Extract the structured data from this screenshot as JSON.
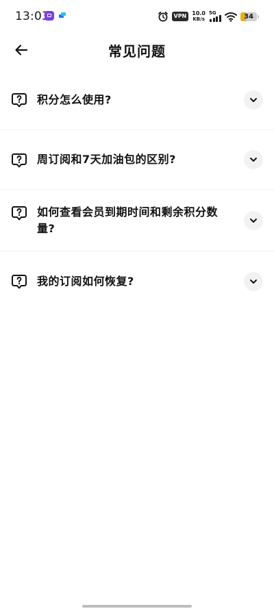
{
  "status_bar": {
    "time": "13:03",
    "vpn_label": "VPN",
    "net_speed_value": "10.0",
    "net_speed_unit": "KB/s",
    "signal_label": "5G",
    "battery_level": "34",
    "battery_fraction": 0.34,
    "battery_color": "#e3b21b",
    "notification_icons": [
      "purple-app-icon",
      "blue-app-icon"
    ]
  },
  "header": {
    "back_icon": "arrow-left-icon",
    "title": "常见问题"
  },
  "faq": {
    "icon": "question-bubble-icon",
    "expand_icon": "chevron-down-icon",
    "items": [
      {
        "question": "积分怎么使用?"
      },
      {
        "question": "周订阅和7天加油包的区别?"
      },
      {
        "question": "如何查看会员到期时间和剩余积分数量?"
      },
      {
        "question": "我的订阅如何恢复?"
      }
    ]
  },
  "colors": {
    "text": "#111111",
    "chevron_bg": "#f2f2f2",
    "divider": "#f1f1f1"
  }
}
